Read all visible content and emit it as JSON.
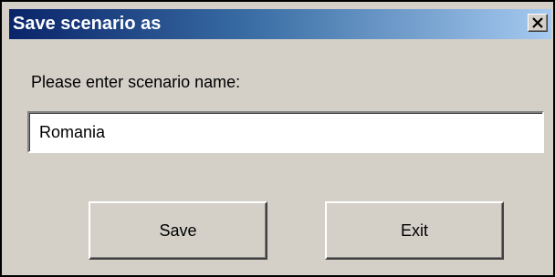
{
  "dialog": {
    "title": "Save scenario as",
    "close_icon": "close-icon",
    "prompt": "Please enter scenario name:",
    "name_field": {
      "value": "Romania",
      "placeholder": ""
    },
    "buttons": {
      "save_label": "Save",
      "exit_label": "Exit"
    }
  },
  "colors": {
    "titlebar_start": "#0a246a",
    "titlebar_end": "#a6caf0",
    "dialog_background": "#d4d0c8",
    "title_text": "#ffffff"
  }
}
